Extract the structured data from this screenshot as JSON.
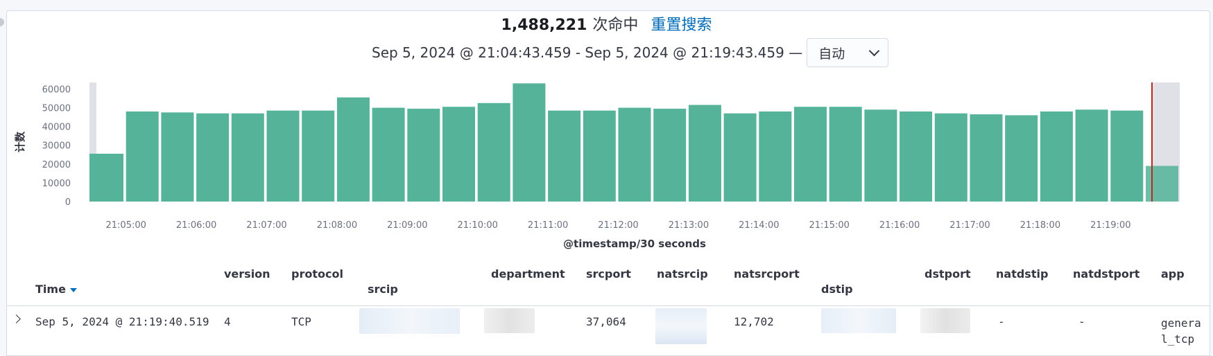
{
  "summary": {
    "hits_count": "1,488,221",
    "hits_label": "次命中",
    "reset_label": "重置搜索"
  },
  "time_range": {
    "text": "Sep 5, 2024 @ 21:04:43.459 - Sep 5, 2024 @ 21:19:43.459 —",
    "interval_value": "自动"
  },
  "colors": {
    "bar": "#54b399",
    "now_line": "#bd271e",
    "partial_bucket": "#dfe1e6"
  },
  "chart_data": {
    "type": "bar",
    "x": [
      "21:04:30",
      "21:05:00",
      "21:05:30",
      "21:06:00",
      "21:06:30",
      "21:07:00",
      "21:07:30",
      "21:08:00",
      "21:08:30",
      "21:09:00",
      "21:09:30",
      "21:10:00",
      "21:10:30",
      "21:11:00",
      "21:11:30",
      "21:12:00",
      "21:12:30",
      "21:13:00",
      "21:13:30",
      "21:14:00",
      "21:14:30",
      "21:15:00",
      "21:15:30",
      "21:16:00",
      "21:16:30",
      "21:17:00",
      "21:17:30",
      "21:18:00",
      "21:18:30",
      "21:19:00",
      "21:19:30"
    ],
    "values": [
      25500,
      48000,
      47500,
      47000,
      47000,
      48500,
      48500,
      55500,
      50000,
      49500,
      50500,
      52500,
      63000,
      48500,
      48500,
      50000,
      49500,
      51500,
      47000,
      48000,
      50500,
      50500,
      49000,
      48000,
      47000,
      46500,
      46000,
      48000,
      49000,
      48500,
      19000
    ],
    "tick_labels": [
      "21:05:00",
      "21:06:00",
      "21:07:00",
      "21:08:00",
      "21:09:00",
      "21:10:00",
      "21:11:00",
      "21:12:00",
      "21:13:00",
      "21:14:00",
      "21:15:00",
      "21:16:00",
      "21:17:00",
      "21:18:00",
      "21:19:00"
    ],
    "y_ticks": [
      0,
      10000,
      20000,
      30000,
      40000,
      50000,
      60000
    ],
    "ylim": [
      0,
      63500
    ],
    "xlabel": "@timestamp/30 seconds",
    "ylabel": "计数",
    "grid": false,
    "partial_buckets": [
      "21:04:30",
      "21:19:30"
    ],
    "now_marker": "21:19:43.459"
  },
  "table": {
    "columns": {
      "time": "Time",
      "version": "version",
      "protocol": "protocol",
      "srcip": "srcip",
      "department": "department",
      "srcport": "srcport",
      "natsrcip": "natsrcip",
      "natsrcport": "natsrcport",
      "dstip": "dstip",
      "dstport": "dstport",
      "natdstip": "natdstip",
      "natdstport": "natdstport",
      "app": "app"
    },
    "rows": [
      {
        "time": "Sep 5, 2024 @ 21:19:40.519",
        "version": "4",
        "protocol": "TCP",
        "srcport": "37,064",
        "natsrcport": "12,702",
        "natdstip": "-",
        "natdstport": "-",
        "app_line1": "genera",
        "app_line2": "l_tcp"
      }
    ]
  }
}
